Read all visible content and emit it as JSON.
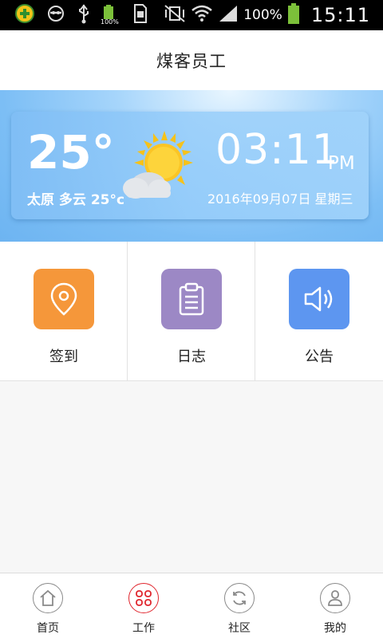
{
  "statusbar": {
    "battery_small_label": "100%",
    "battery_percent": "100%",
    "time": "15:11"
  },
  "header": {
    "title": "煤客员工"
  },
  "weather": {
    "temperature": "25°",
    "location_summary": "太原 多云 25°c",
    "icon": "sun-behind-cloud-icon",
    "clock_time": "03:11",
    "clock_ampm": "PM",
    "date": "2016年09月07日 星期三"
  },
  "actions": [
    {
      "label": "签到",
      "icon": "location-pin-icon",
      "color": "#f5973a"
    },
    {
      "label": "日志",
      "icon": "clipboard-icon",
      "color": "#9c88c5"
    },
    {
      "label": "公告",
      "icon": "speaker-icon",
      "color": "#5d96f0"
    }
  ],
  "nav": {
    "active_color": "#e0262e",
    "items": [
      {
        "label": "首页",
        "icon": "home-icon"
      },
      {
        "label": "工作",
        "icon": "apps-grid-icon",
        "active": true
      },
      {
        "label": "社区",
        "icon": "refresh-icon"
      },
      {
        "label": "我的",
        "icon": "person-icon"
      }
    ]
  }
}
